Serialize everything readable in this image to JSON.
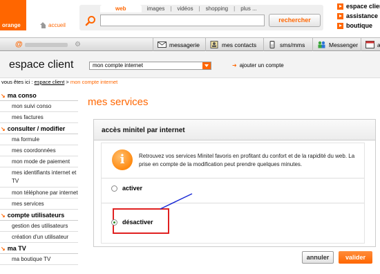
{
  "header": {
    "logo_text": "orange",
    "home_label": "accueil",
    "search": {
      "tabs": [
        "web",
        "images",
        "vidéos",
        "shopping",
        "plus ..."
      ],
      "active_tab": "web",
      "value": "",
      "button_label": "rechercher"
    },
    "top_links": [
      "espace client",
      "assistance",
      "boutique"
    ]
  },
  "navbar": {
    "items": [
      {
        "label": "messagerie",
        "icon": "envelope-icon"
      },
      {
        "label": "mes contacts",
        "icon": "contacts-icon"
      },
      {
        "label": "sms/mms",
        "icon": "sms-icon"
      },
      {
        "label": "Messenger",
        "icon": "messenger-icon"
      },
      {
        "label": "ag",
        "icon": "calendar-icon"
      }
    ]
  },
  "espace": {
    "title": "espace client",
    "account_select_value": "mon compte internet",
    "add_account_label": "ajouter un compte"
  },
  "breadcrumb": {
    "prefix": "vous êtes ici :",
    "link": "espace client",
    "separator": ">",
    "current": "mon compte internet"
  },
  "sidebar": {
    "sections": [
      {
        "title": "ma conso",
        "items": [
          "mon suivi conso",
          "mes factures"
        ]
      },
      {
        "title": "consulter / modifier",
        "items": [
          "ma formule",
          "mes coordonnées",
          "mon mode de paiement",
          "mes identifiants internet et TV",
          "mon téléphone par internet",
          "mes services"
        ]
      },
      {
        "title": "compte utilisateurs",
        "items": [
          "gestion des utilisateurs",
          "création d'un utilisateur"
        ]
      },
      {
        "title": "ma TV",
        "items": [
          "ma boutique TV"
        ]
      }
    ]
  },
  "main": {
    "page_title": "mes services",
    "panel_title": "accès minitel par internet",
    "info_text": "Retrouvez vos services Minitel favoris en profitant du confort et de la rapidité du web. La prise en compte de la modification peut prendre quelques minutes.",
    "options": [
      {
        "label": "activer",
        "selected": false
      },
      {
        "label": "désactiver",
        "selected": true
      }
    ],
    "cancel_label": "annuler",
    "ok_label": "valider"
  },
  "colors": {
    "brand": "#ff6600",
    "highlight": "#e02020",
    "pointer": "#1a2ad6"
  }
}
